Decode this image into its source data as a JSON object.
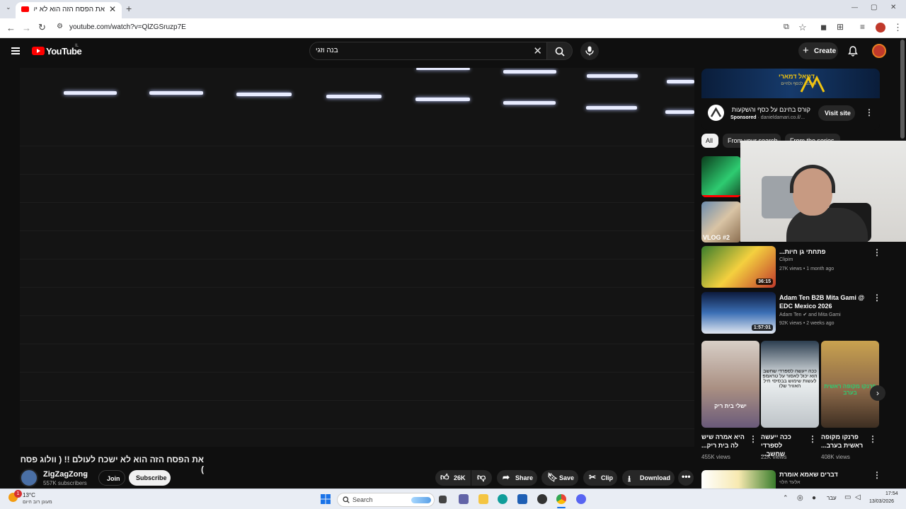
{
  "browser": {
    "tab_title": "את הפסח הזה הוא לא ישכח לעולם !!",
    "tab_close": "✕",
    "new_tab": "+",
    "url": "youtube.com/watch?v=QlZGSruzp7E",
    "window_controls": [
      "—",
      "▢",
      "✕"
    ]
  },
  "youtube": {
    "logo_text": "YouTube",
    "logo_region": "IL",
    "search_value": "בנה וזגי",
    "create_label": "Create"
  },
  "video": {
    "title": "את הפסח הזה הוא לא ישכח לעולם !! ( וולוג פסח )",
    "channel_name": "ZigZagZong",
    "channel_subs": "557K subscribers",
    "join_label": "Join",
    "subscribe_label": "Subscribe",
    "likes": "26K",
    "share_label": "Share",
    "save_label": "Save",
    "clip_label": "Clip",
    "download_label": "Download"
  },
  "ad": {
    "banner_title": "דניאל דמארי",
    "banner_sub": "ההכנה לכסף ולחיים",
    "title": "קורס בחינם על כסף והשקעות",
    "sponsored": "Sponsored",
    "domain": "danieldamari.co.il/...",
    "visit_label": "Visit site"
  },
  "chips": [
    "All",
    "From your search",
    "From the series"
  ],
  "related": [
    {
      "title": "פתחתי גן חיות...",
      "channel": "Clipim",
      "meta": "27K views • 1 month ago",
      "duration": "36:15"
    },
    {
      "title": "Adam Ten B2B Mita Gami @ EDC Mexico 2026",
      "channel": "Adam Ten",
      "channel_extra": "and Mita Gami",
      "meta": "92K views • 2 weeks ago",
      "duration": "1:57:01"
    },
    {
      "title": "דברים שאמא אומרת",
      "channel": "אלעד הלוי",
      "meta": "",
      "duration": ""
    }
  ],
  "vlog_badge": "VLOG #2",
  "shorts": [
    {
      "title": "היא אמרה שיש לה בית ריק...",
      "views": "455K views",
      "overlay": "ישלי בית ריק"
    },
    {
      "title": "ככה ייעשה לספרדי שחשב...",
      "views": "22K views",
      "overlay": "ככה ייעשה לספרדי שחשב הוא יכול לאסור על טראמפ לעשות שימוש בבסיסי חיל האוויר שלו"
    },
    {
      "title": "פרנקו מקופה ראשית בערב...",
      "views": "408K views",
      "overlay": "פרנקו מקופה ראשית בערב"
    }
  ],
  "taskbar": {
    "weather_temp": "13°C",
    "weather_desc": "מעונן רוב היום",
    "search_label": "Search",
    "lang": "עבר",
    "time": "17:54",
    "date": "13/03/2026",
    "notification_count": "1"
  },
  "colors": {
    "yt_bg": "#0f0f0f",
    "yt_red": "#ff0000",
    "pill_bg": "#272727",
    "taskbar_bg": "#e9edf4"
  }
}
